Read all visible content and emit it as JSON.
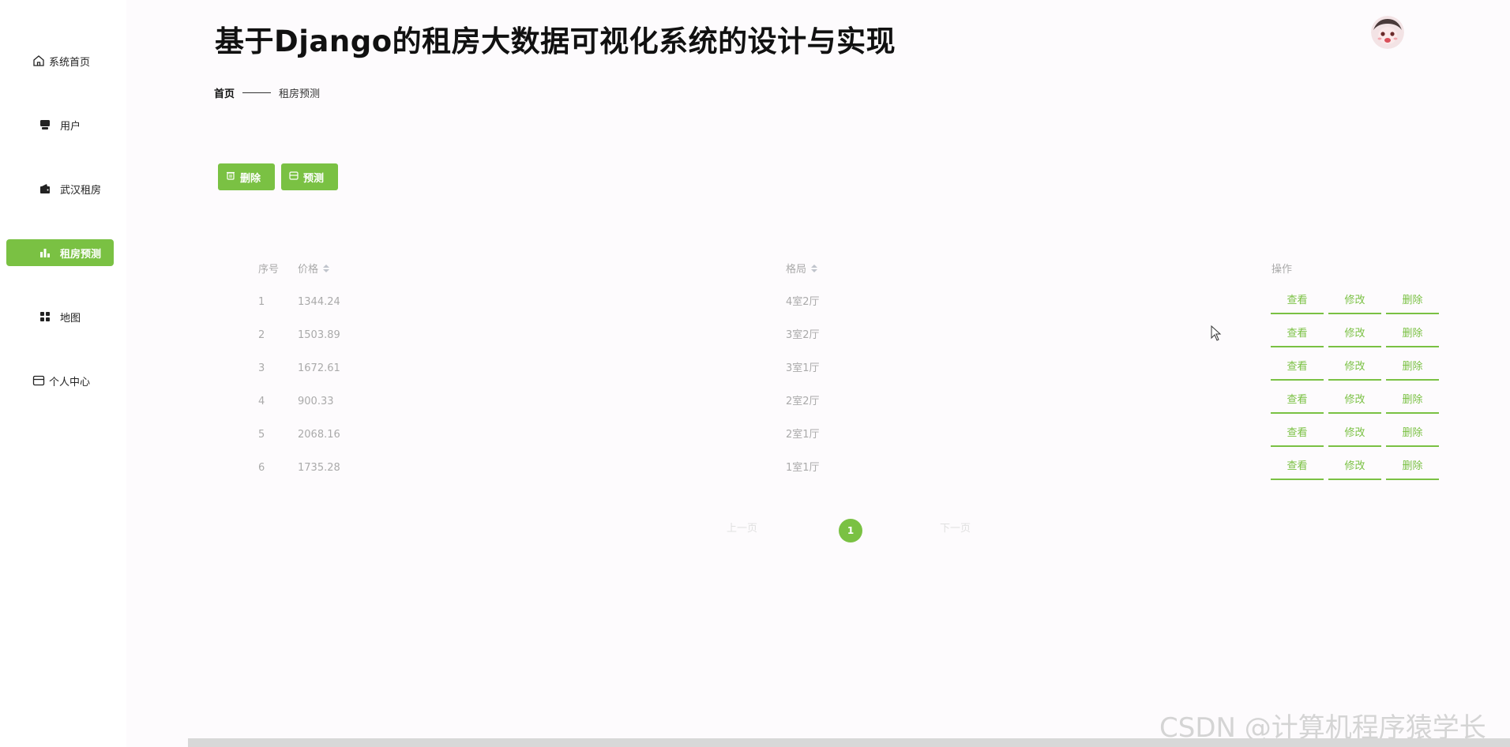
{
  "title": "基于Django的租房大数据可视化系统的设计与实现",
  "sidebar": {
    "items": [
      {
        "label": "系统首页",
        "icon": "home-icon",
        "active": false
      },
      {
        "label": "用户",
        "icon": "user-icon",
        "active": false
      },
      {
        "label": "武汉租房",
        "icon": "wallet-icon",
        "active": false
      },
      {
        "label": "租房预测",
        "icon": "bar-chart-icon",
        "active": true
      },
      {
        "label": "地图",
        "icon": "grid-icon",
        "active": false
      },
      {
        "label": "个人中心",
        "icon": "card-icon",
        "active": false
      }
    ]
  },
  "breadcrumb": {
    "home": "首页",
    "current": "租房预测"
  },
  "toolbar": {
    "delete_label": "删除",
    "predict_label": "预测"
  },
  "table": {
    "columns": {
      "index": "序号",
      "price": "价格",
      "layout": "格局",
      "actions": "操作"
    },
    "rows": [
      {
        "index": "1",
        "price": "1344.24",
        "layout": "4室2厅"
      },
      {
        "index": "2",
        "price": "1503.89",
        "layout": "3室2厅"
      },
      {
        "index": "3",
        "price": "1672.61",
        "layout": "3室1厅"
      },
      {
        "index": "4",
        "price": "900.33",
        "layout": "2室2厅"
      },
      {
        "index": "5",
        "price": "2068.16",
        "layout": "2室1厅"
      },
      {
        "index": "6",
        "price": "1735.28",
        "layout": "1室1厅"
      }
    ],
    "row_actions": {
      "view": "查看",
      "edit": "修改",
      "delete": "删除"
    }
  },
  "pagination": {
    "prev": "上一页",
    "current": "1",
    "next": "下一页"
  },
  "watermark": "CSDN @计算机程序猿学长",
  "colors": {
    "accent": "#7ac143",
    "muted_text": "#aaaaaa",
    "background": "#fdfbfd"
  }
}
